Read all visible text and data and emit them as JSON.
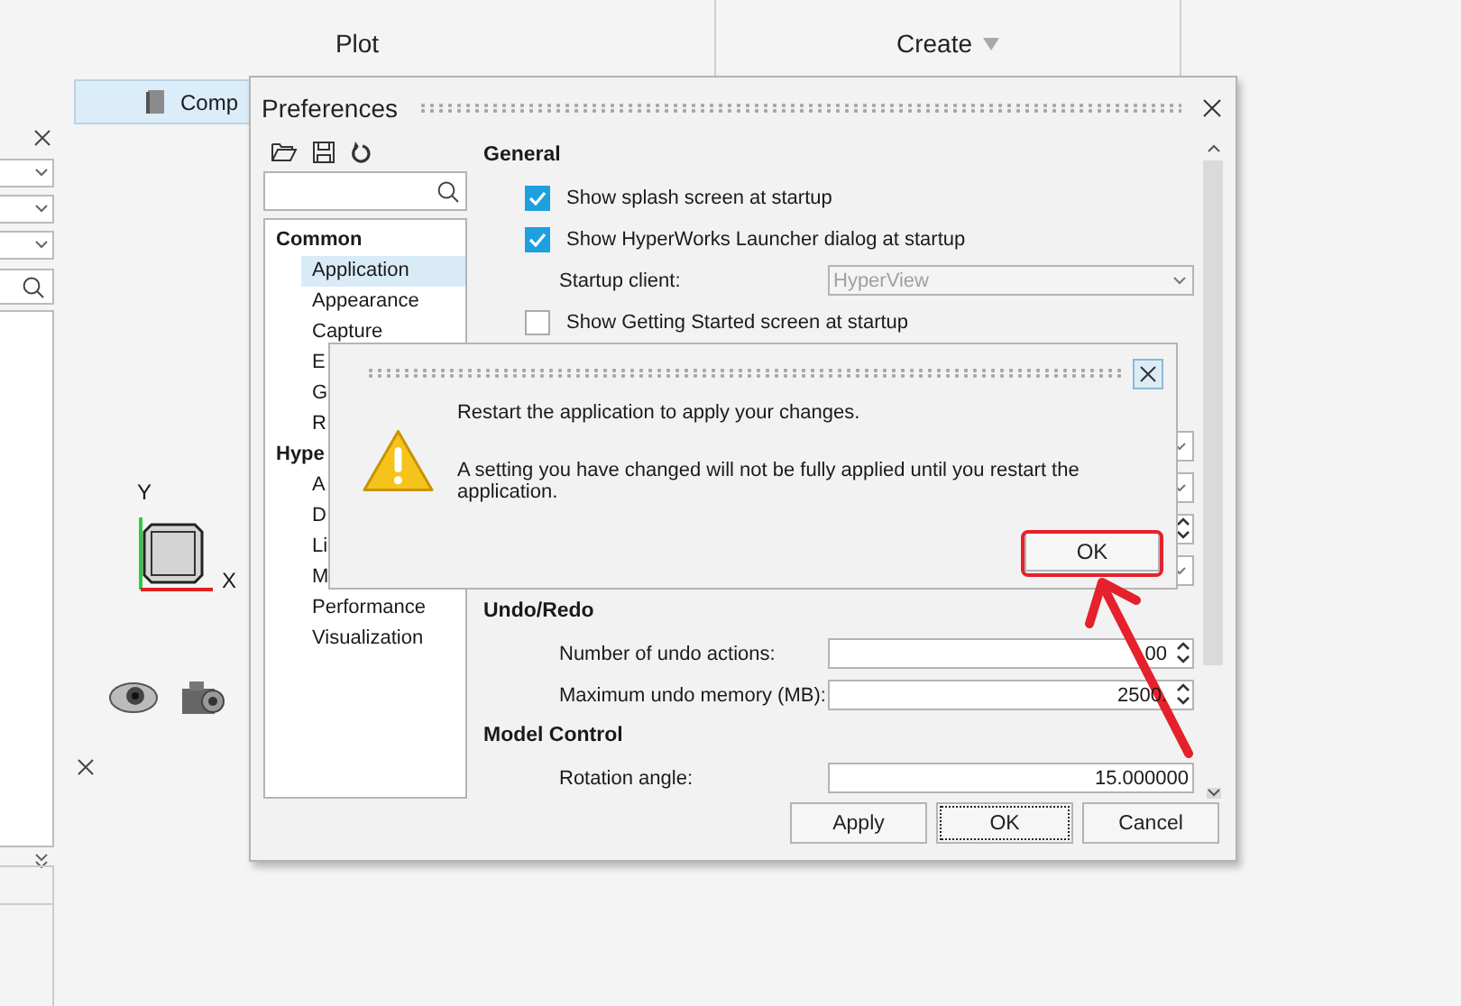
{
  "top_bar": {
    "columns": [
      {
        "label": "Plot",
        "menu": false
      },
      {
        "label": "Create",
        "menu": true
      }
    ]
  },
  "background": {
    "component_tab": "Comp",
    "axis_labels": {
      "y": "Y",
      "x": "X"
    }
  },
  "preferences": {
    "title": "Preferences",
    "tree": [
      {
        "label": "Common",
        "children": [
          {
            "label": "Application",
            "selected": true
          },
          {
            "label": "Appearance",
            "selected": false
          },
          {
            "label": "Capture",
            "selected": false
          },
          {
            "label": "E",
            "selected": false
          },
          {
            "label": "G",
            "selected": false
          },
          {
            "label": "R",
            "selected": false
          }
        ]
      },
      {
        "label": "Hype",
        "children": [
          {
            "label": "A",
            "selected": false
          },
          {
            "label": "D",
            "selected": false
          },
          {
            "label": "Li",
            "selected": false
          },
          {
            "label": "M",
            "selected": false
          },
          {
            "label": "Performance",
            "selected": false
          },
          {
            "label": "Visualization",
            "selected": false
          }
        ]
      }
    ],
    "sections": [
      {
        "heading": "General",
        "rows": [
          {
            "kind": "checkbox",
            "label": "Show splash screen at startup",
            "checked": true
          },
          {
            "kind": "checkbox",
            "label": "Show HyperWorks Launcher dialog at startup",
            "checked": true
          },
          {
            "kind": "select",
            "label": "Startup client:",
            "value": "HyperView",
            "disabled": true
          },
          {
            "kind": "checkbox",
            "label": "Show Getting Started screen at startup",
            "checked": false
          }
        ]
      },
      {
        "rows": [
          {
            "kind": "select"
          },
          {
            "kind": "select"
          },
          {
            "kind": "spinner"
          },
          {
            "kind": "select"
          }
        ]
      },
      {
        "heading": "Undo/Redo",
        "rows": [
          {
            "kind": "spinner",
            "label": "Number of undo actions:",
            "value": "00"
          },
          {
            "kind": "spinner",
            "label": "Maximum undo memory (MB):",
            "value": "2500."
          }
        ]
      },
      {
        "heading": "Model Control",
        "rows": [
          {
            "kind": "field",
            "label": "Rotation angle:",
            "value": "15.000000"
          }
        ]
      }
    ],
    "buttons": [
      {
        "label": "Apply",
        "focused": false
      },
      {
        "label": "OK",
        "focused": true
      },
      {
        "label": "Cancel",
        "focused": false
      }
    ]
  },
  "alert": {
    "message": "Restart the application to apply your changes.",
    "detail": "A setting you have changed will not be fully applied until you restart the application.",
    "button": "OK",
    "highlighted": true
  }
}
